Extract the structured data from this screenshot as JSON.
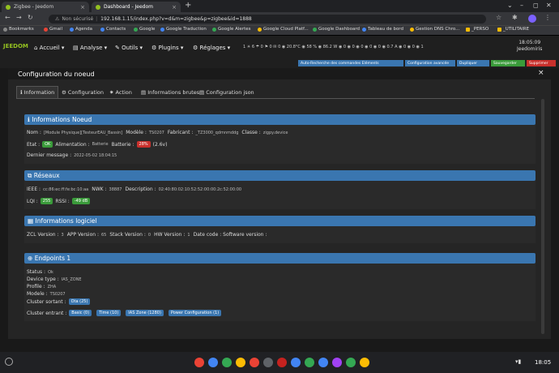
{
  "browser": {
    "tabs": [
      {
        "title": "Zigbee - Jeedom",
        "favicon_color": "#94c120"
      },
      {
        "title": "Dashboard - Jeedom",
        "favicon_color": "#94c120"
      }
    ],
    "new_tab_symbol": "+",
    "security_label": "Non sécurisé",
    "url": "192.168.1.15/index.php?v=d&m=zigbee&p=zigbee&id=1888",
    "bookmarks": [
      "Bookmarks",
      "Gmail",
      "Agenda",
      "Contacts",
      "Google",
      "Google Traduction",
      "Google Alertes",
      "Google Cloud Platf...",
      "Google Dashboard",
      "Tableau de bord",
      "Gestion DNS Chro...",
      "_PERSO",
      "_UTILITAIRE"
    ]
  },
  "jeedom": {
    "logo": "JEEDOM",
    "menus": [
      "Accueil",
      "Analyse",
      "Outils",
      "Plugins",
      "Réglages"
    ],
    "time": "18:05:09",
    "user": "Jeedomiris",
    "status_text": "1 ☀ 6 ☂ 0 ⚑ 0 ✉ 0 ◉ 20.8°C ◉ 58 % ◉ 86.2 W ◉ 0 ◉ 0 ◉ 0 ◉ 0 ◉ 0 ◉ 0.7 A ◉ 0 ◉ 0 ◉ 1",
    "row_buttons": [
      {
        "label": "Auto-Recherche des commandes Eléments",
        "color": "#3a76b0"
      },
      {
        "label": "Configuration avancée",
        "color": "#3a76b0"
      },
      {
        "label": "Dupliquer",
        "color": "#3a76b0"
      },
      {
        "label": "Sauvegarder",
        "color": "#3a9b3a"
      },
      {
        "label": "Supprimer",
        "color": "#c9302c"
      }
    ]
  },
  "modal": {
    "title": "Configuration du noeud",
    "close": "×",
    "tabs": [
      "Information",
      "Configuration",
      "Action",
      "Informations brutes",
      "Configuration json"
    ]
  },
  "info_noeud": {
    "title": "Informations Noeud",
    "nom_label": "Nom :",
    "nom": "[Module Physique][TesteurEAU_Bassin]",
    "modele_label": "Modèle :",
    "modele": "TS0207",
    "fabricant_label": "Fabricant :",
    "fabricant": "_TZ3000_qdmnmddg",
    "classe_label": "Classe :",
    "classe": "zigpy.device",
    "etat_label": "Etat :",
    "etat": "OK",
    "alim_label": "Alimentation :",
    "alim": "Batterie",
    "batterie_label": "Batterie :",
    "batterie": "28%",
    "tension": "(2.6v)",
    "dernier_label": "Dernier message :",
    "dernier": "2022-05-02 18:04:15"
  },
  "reseaux": {
    "title": "Réseaux",
    "ieee_label": "IEEE :",
    "ieee": "cc:86:ec:ff:fe:bc:10:aa",
    "nwk_label": "NWK :",
    "nwk": "38887",
    "desc_label": "Description :",
    "desc": "02:40:80:02:10:52:52:00:00:2c:52:00:00",
    "lqi_label": "LQI :",
    "lqi": "255",
    "rssi_label": "RSSI :",
    "rssi": "-49 dB"
  },
  "logiciel": {
    "title": "Informations logiciel",
    "zcl_label": "ZCL Version :",
    "zcl": "3",
    "app_label": "APP Version :",
    "app": "65",
    "stack_label": "Stack Version :",
    "stack": "0",
    "hw_label": "HW Version :",
    "hw": "1",
    "date_label": "Date code : Software version :"
  },
  "endpoints": {
    "title": "Endpoints 1",
    "status_label": "Status :",
    "status": "Ok",
    "device_label": "Device type :",
    "device": "IAS_ZONE",
    "profile_label": "Profile :",
    "profile": "ZHA",
    "modele_label": "Modele :",
    "modele": "TS0207",
    "sortant_label": "Cluster sortant :",
    "sortant": [
      "Ota (25)"
    ],
    "entrant_label": "Cluster entrant :",
    "entrant": [
      "Basic (0)",
      "Time (10)",
      "IAS Zone (1280)",
      "Power Configuration (1)"
    ]
  },
  "taskbar": {
    "time": "18:05",
    "apps": [
      "#ea4335",
      "#4285f4",
      "#34a853",
      "#fbbc04",
      "#ea4335",
      "#5f6368",
      "#c5221f",
      "#4285f4",
      "#34a853",
      "#4285f4",
      "#a142f4",
      "#34a853",
      "#fbbc04"
    ]
  }
}
